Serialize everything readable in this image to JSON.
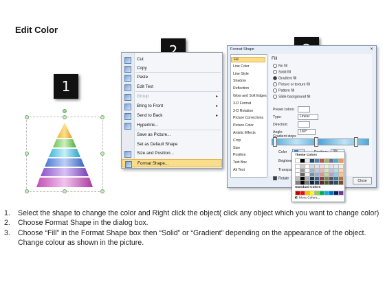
{
  "title": "Edit Color",
  "badges": [
    "1",
    "2",
    "3"
  ],
  "context_menu": {
    "items": [
      {
        "label": "Cut",
        "icon": "scissors-icon",
        "disabled": false,
        "arrow": false
      },
      {
        "label": "Copy",
        "icon": "copy-icon",
        "disabled": false,
        "arrow": false
      },
      {
        "label": "Paste",
        "icon": "paste-icon",
        "disabled": false,
        "arrow": false
      },
      {
        "label": "Edit Text",
        "icon": "edit-text-icon",
        "disabled": false,
        "arrow": false
      },
      {
        "label": "Group",
        "icon": "group-icon",
        "disabled": true,
        "arrow": true
      },
      {
        "label": "Bring to Front",
        "icon": "bring-front-icon",
        "disabled": false,
        "arrow": true
      },
      {
        "label": "Send to Back",
        "icon": "send-back-icon",
        "disabled": false,
        "arrow": true
      },
      {
        "label": "Hyperlink...",
        "icon": "hyperlink-icon",
        "disabled": false,
        "arrow": false
      },
      {
        "label": "Save as Picture...",
        "icon": "",
        "disabled": false,
        "arrow": false
      },
      {
        "label": "Set as Default Shape",
        "icon": "",
        "disabled": false,
        "arrow": false
      },
      {
        "label": "Size and Position...",
        "icon": "size-icon",
        "disabled": false,
        "arrow": false
      },
      {
        "label": "Format Shape...",
        "icon": "format-shape-icon",
        "disabled": false,
        "arrow": false,
        "highlighted": true
      }
    ]
  },
  "dialog": {
    "title": "Format Shape",
    "close_glyph": "✕",
    "categories": [
      "Fill",
      "Line Color",
      "Line Style",
      "Shadow",
      "Reflection",
      "Glow and Soft Edges",
      "3-D Format",
      "3-D Rotation",
      "Picture Corrections",
      "Picture Color",
      "Artistic Effects",
      "Crop",
      "Size",
      "Position",
      "Text Box",
      "Alt Text"
    ],
    "selected_category": "Fill",
    "fill_heading": "Fill",
    "fill_options": [
      {
        "label": "No fill",
        "checked": false
      },
      {
        "label": "Solid fill",
        "checked": false
      },
      {
        "label": "Gradient fill",
        "checked": true
      },
      {
        "label": "Picture or texture fill",
        "checked": false
      },
      {
        "label": "Pattern fill",
        "checked": false
      },
      {
        "label": "Slide background fill",
        "checked": false
      }
    ],
    "preset_colors_label": "Preset colors:",
    "type_label": "Type:",
    "type_value": "Linear",
    "direction_label": "Direction:",
    "angle_label": "Angle:",
    "angle_value": "180°",
    "gradient_stops_label": "Gradient stops",
    "color_label": "Color",
    "position_label": "Position:",
    "position_value": "0%",
    "brightness_label": "Brightne",
    "transparency_label": "Transpare",
    "rotate_label": "Rotate",
    "close_button": "Close"
  },
  "palette": {
    "theme_heading": "Theme Colors",
    "standard_heading": "Standard Colors",
    "more_colors": "More Colors...",
    "theme_top": [
      "#ffffff",
      "#000000",
      "#eeece1",
      "#1f497d",
      "#4f81bd",
      "#c0504d",
      "#9bbb59",
      "#8064a2",
      "#4bacc6",
      "#f79646"
    ],
    "standard": [
      "#c00000",
      "#ff0000",
      "#ffc000",
      "#ffff00",
      "#92d050",
      "#00b050",
      "#00b0f0",
      "#0070c0",
      "#002060",
      "#7030a0"
    ]
  },
  "steps": [
    {
      "num": "1.",
      "text": "Select the shape to change the color and Right click the object( click any object which you want to change color)"
    },
    {
      "num": "2.",
      "text": "Choose Format Shape in the dialog box."
    },
    {
      "num": "3.",
      "text": "Choose “Fill” in the Format Shape box then “Solid” or “Gradient” depending on the appearance of the object. Change colour as shown in the picture."
    }
  ]
}
